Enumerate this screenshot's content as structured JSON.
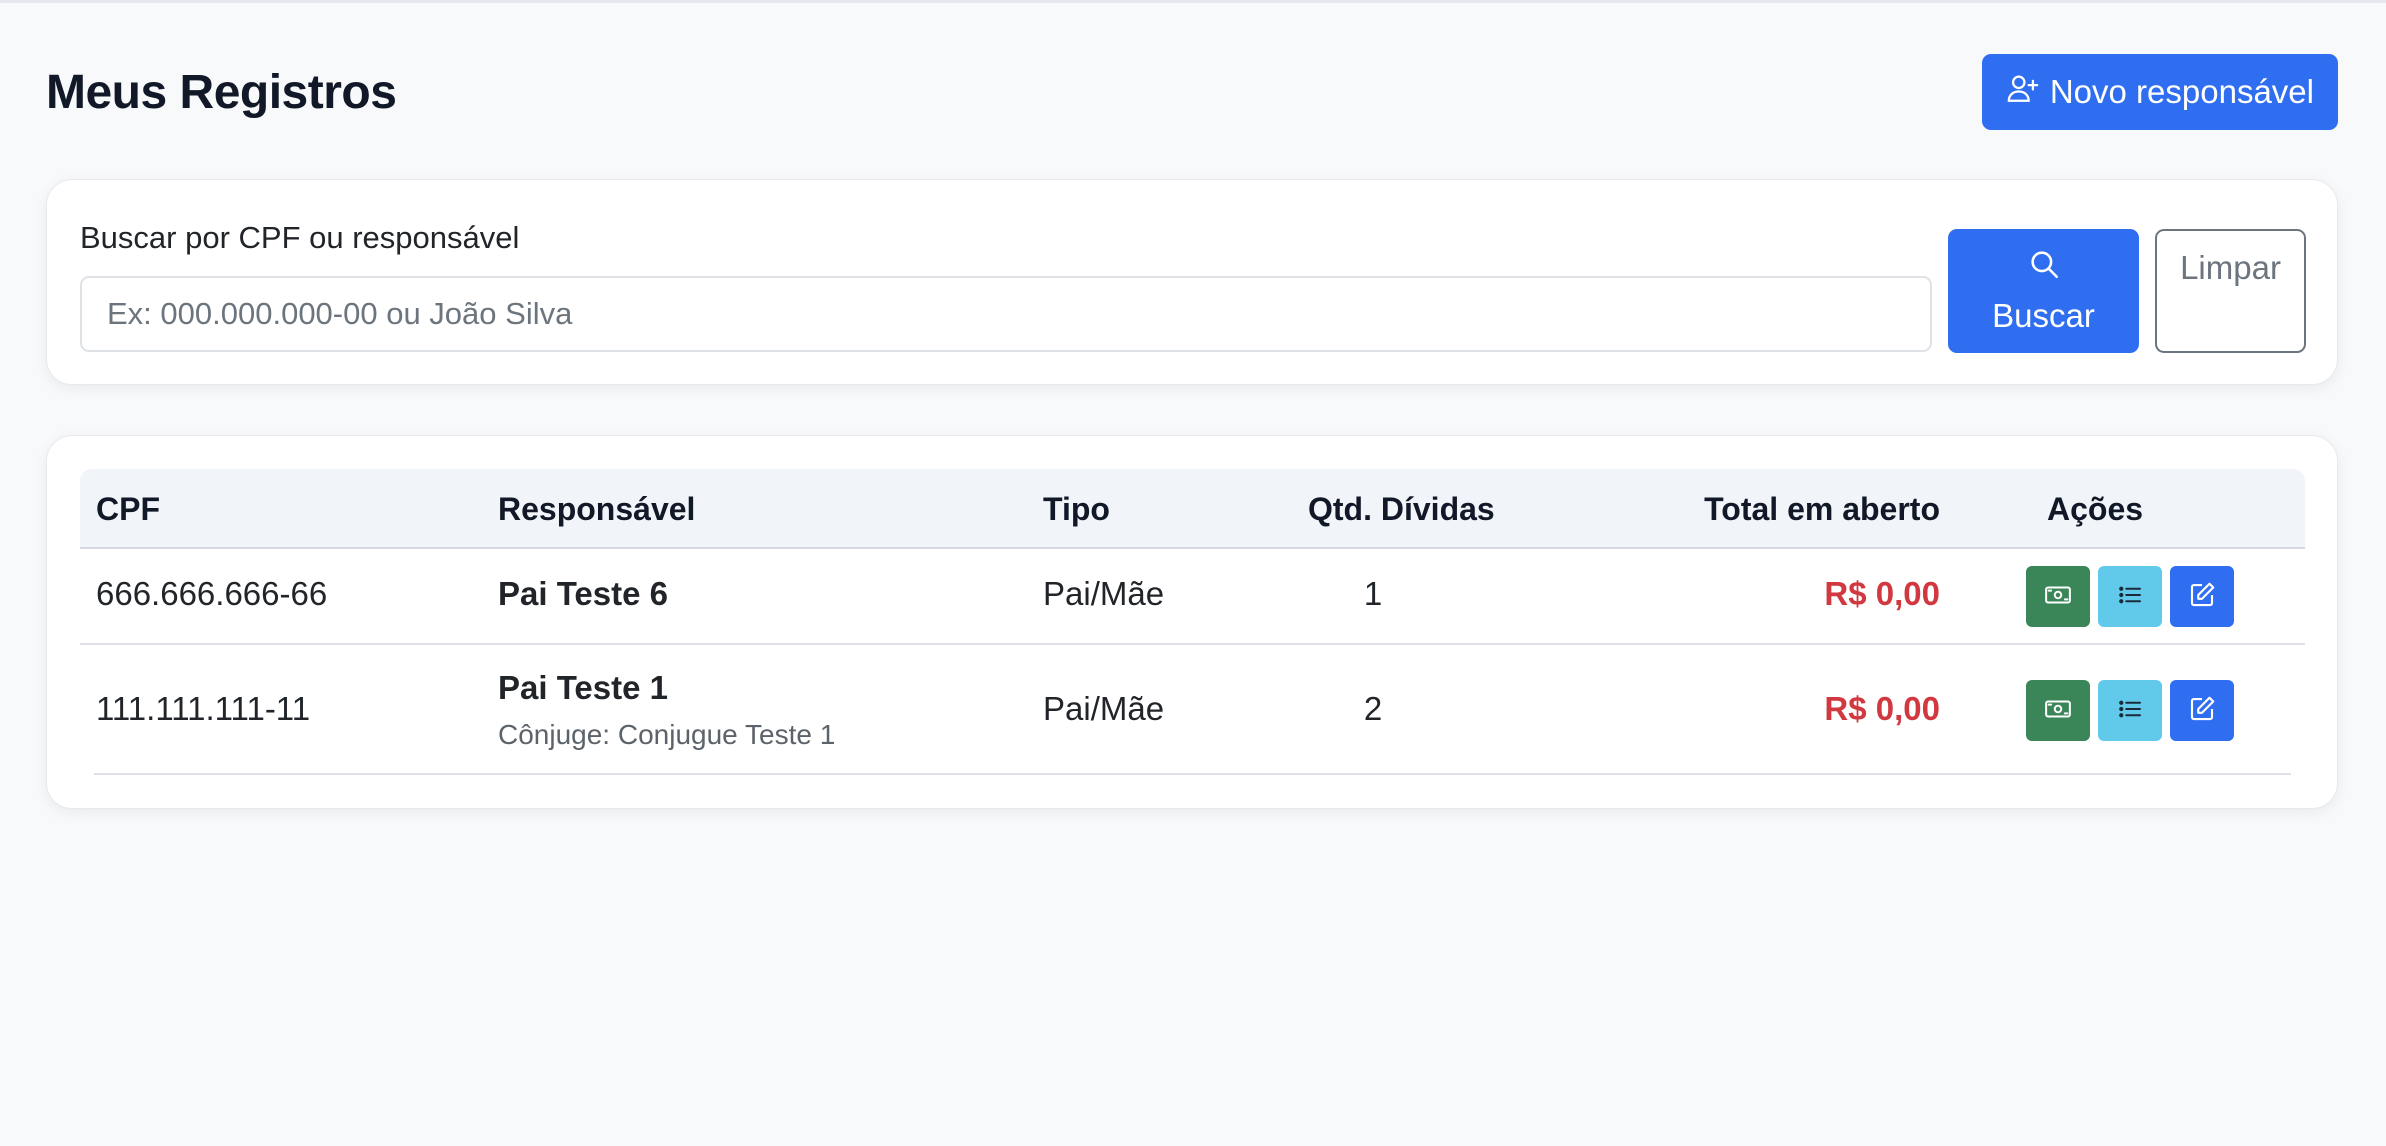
{
  "header": {
    "title": "Meus Registros",
    "new_button_label": "Novo responsável"
  },
  "search": {
    "label": "Buscar por CPF ou responsável",
    "placeholder": "Ex: 000.000.000-00 ou João Silva",
    "value": "",
    "search_button_label": "Buscar",
    "clear_button_label": "Limpar"
  },
  "table": {
    "columns": [
      "CPF",
      "Responsável",
      "Tipo",
      "Qtd. Dívidas",
      "Total em aberto",
      "Ações"
    ],
    "rows": [
      {
        "cpf": "666.666.666-66",
        "name": "Pai Teste 6",
        "spouse": "",
        "tipo": "Pai/Mãe",
        "qtd": "1",
        "total": "R$ 0,00"
      },
      {
        "cpf": "111.111.111-11",
        "name": "Pai Teste 1",
        "spouse": "Cônjuge: Conjugue Teste 1",
        "tipo": "Pai/Mãe",
        "qtd": "2",
        "total": "R$ 0,00"
      }
    ],
    "action_icons": [
      "cash-icon",
      "list-icon",
      "edit-icon"
    ]
  },
  "colors": {
    "primary": "#2f6ef0",
    "success": "#3a8658",
    "info": "#61c9ea",
    "danger": "#d1383f"
  }
}
